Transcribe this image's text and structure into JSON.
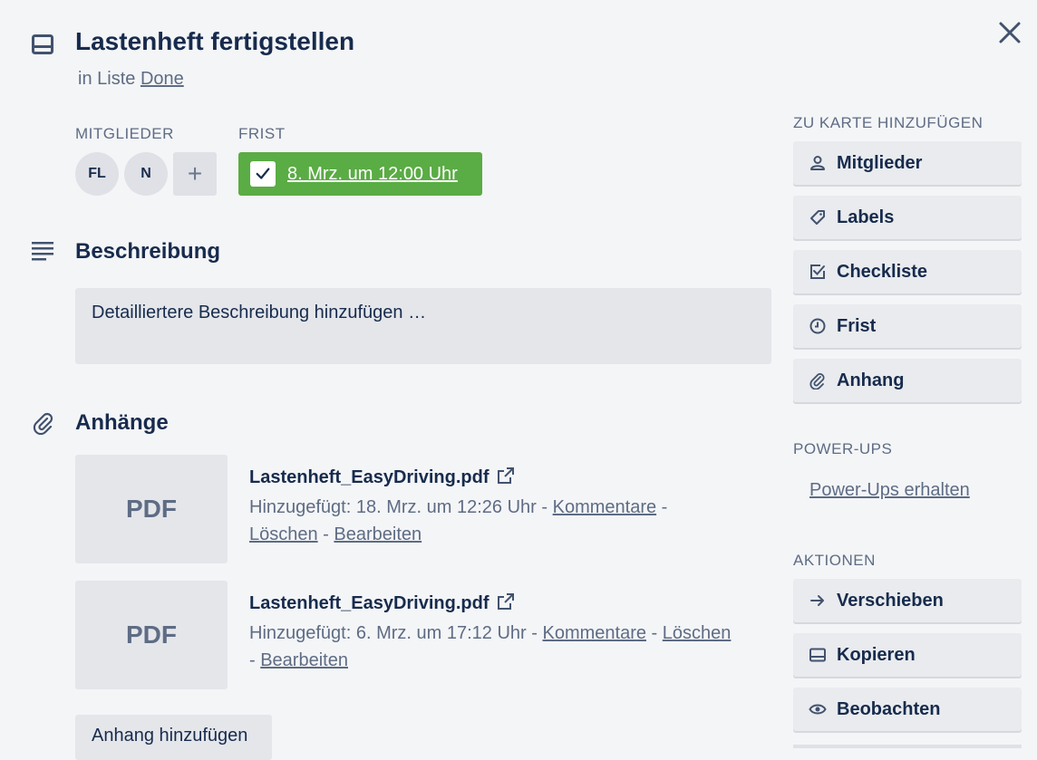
{
  "card": {
    "title": "Lastenheft fertigstellen",
    "list_prefix": "in Liste",
    "list_name": "Done"
  },
  "members": {
    "label": "MITGLIEDER",
    "avatars": [
      "FL",
      "N"
    ],
    "add_label": "+"
  },
  "due": {
    "label": "FRIST",
    "value": "8. Mrz. um 12:00 Uhr",
    "complete": true,
    "color": "#5aac44"
  },
  "description": {
    "title": "Beschreibung",
    "placeholder": "Detailliertere Beschreibung hinzufügen …"
  },
  "attachments": {
    "title": "Anhänge",
    "items": [
      {
        "thumb": "PDF",
        "name": "Lastenheft_EasyDriving.pdf",
        "added": "Hinzugefügt: 18. Mrz. um 12:26 Uhr",
        "comment": "Kommentare",
        "delete": "Löschen",
        "edit": "Bearbeiten"
      },
      {
        "thumb": "PDF",
        "name": "Lastenheft_EasyDriving.pdf",
        "added": "Hinzugefügt: 6. Mrz. um 17:12 Uhr",
        "comment": "Kommentare",
        "delete": "Löschen",
        "edit": "Bearbeiten"
      }
    ],
    "add_button": "Anhang hinzufügen"
  },
  "sidebar": {
    "add_to_card_label": "ZU KARTE HINZUFÜGEN",
    "add_buttons": [
      {
        "label": "Mitglieder",
        "icon": "person-icon"
      },
      {
        "label": "Labels",
        "icon": "tag-icon"
      },
      {
        "label": "Checkliste",
        "icon": "checklist-icon"
      },
      {
        "label": "Frist",
        "icon": "clock-icon"
      },
      {
        "label": "Anhang",
        "icon": "paperclip-icon"
      }
    ],
    "powerups_label": "POWER-UPS",
    "powerups_link": "Power-Ups erhalten",
    "actions_label": "AKTIONEN",
    "action_buttons": [
      {
        "label": "Verschieben",
        "icon": "arrow-right-icon"
      },
      {
        "label": "Kopieren",
        "icon": "card-icon"
      },
      {
        "label": "Beobachten",
        "icon": "eye-icon"
      }
    ]
  }
}
